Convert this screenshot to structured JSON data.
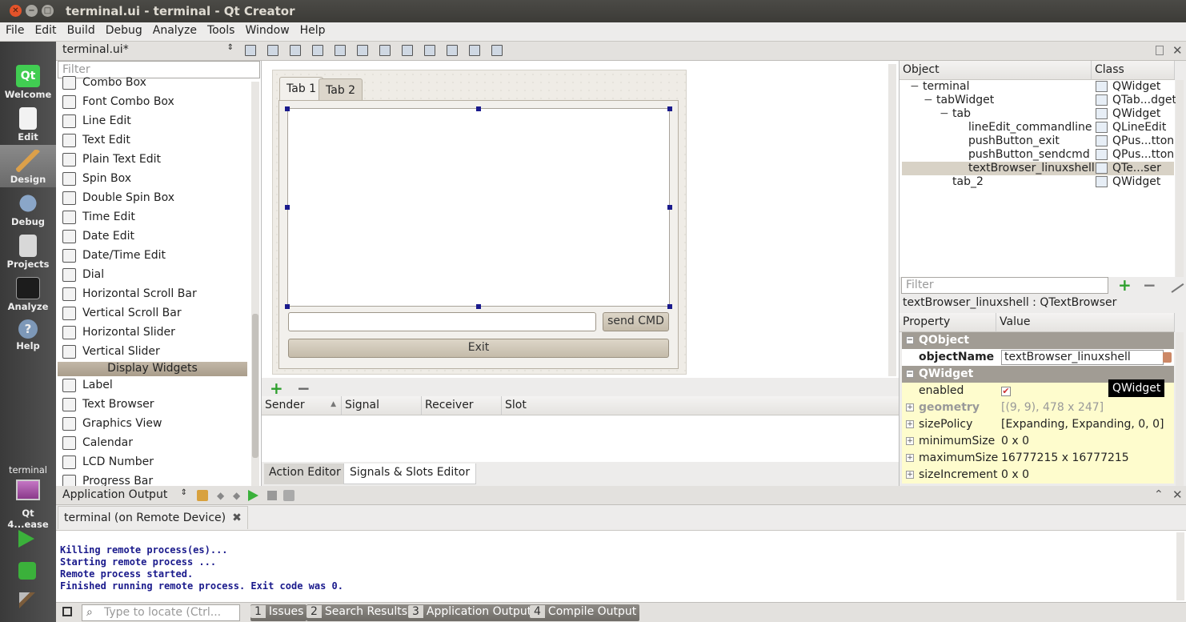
{
  "window": {
    "title": "terminal.ui - terminal - Qt Creator"
  },
  "menu": [
    "File",
    "Edit",
    "Build",
    "Debug",
    "Analyze",
    "Tools",
    "Window",
    "Help"
  ],
  "modes": [
    {
      "label": "Welcome"
    },
    {
      "label": "Edit"
    },
    {
      "label": "Design"
    },
    {
      "label": "Debug"
    },
    {
      "label": "Projects"
    },
    {
      "label": "Analyze"
    },
    {
      "label": "Help"
    }
  ],
  "kit": {
    "project": "terminal",
    "config": "Qt 4...ease"
  },
  "editor": {
    "file": "terminal.ui*"
  },
  "widgetbox": {
    "filter_placeholder": "Filter",
    "items": [
      {
        "label": "Combo Box",
        "icon": "combo-box-icon"
      },
      {
        "label": "Font Combo Box",
        "icon": "font-combo-box-icon"
      },
      {
        "label": "Line Edit",
        "icon": "line-edit-icon"
      },
      {
        "label": "Text Edit",
        "icon": "text-edit-icon"
      },
      {
        "label": "Plain Text Edit",
        "icon": "plain-text-edit-icon"
      },
      {
        "label": "Spin Box",
        "icon": "spin-box-icon"
      },
      {
        "label": "Double Spin Box",
        "icon": "double-spin-box-icon"
      },
      {
        "label": "Time Edit",
        "icon": "time-edit-icon"
      },
      {
        "label": "Date Edit",
        "icon": "date-edit-icon"
      },
      {
        "label": "Date/Time Edit",
        "icon": "date-time-edit-icon"
      },
      {
        "label": "Dial",
        "icon": "dial-icon"
      },
      {
        "label": "Horizontal Scroll Bar",
        "icon": "horizontal-scroll-bar-icon"
      },
      {
        "label": "Vertical Scroll Bar",
        "icon": "vertical-scroll-bar-icon"
      },
      {
        "label": "Horizontal Slider",
        "icon": "horizontal-slider-icon"
      },
      {
        "label": "Vertical Slider",
        "icon": "vertical-slider-icon"
      },
      {
        "label": "Label",
        "icon": "label-icon"
      },
      {
        "label": "Text Browser",
        "icon": "text-browser-icon"
      },
      {
        "label": "Graphics View",
        "icon": "graphics-view-icon"
      },
      {
        "label": "Calendar",
        "icon": "calendar-icon"
      },
      {
        "label": "LCD Number",
        "icon": "lcd-number-icon"
      },
      {
        "label": "Progress Bar",
        "icon": "progress-bar-icon"
      }
    ],
    "category": "Display Widgets"
  },
  "form": {
    "tabs": [
      "Tab 1",
      "Tab 2"
    ],
    "send_label": "send CMD",
    "exit_label": "Exit"
  },
  "signals": {
    "columns": [
      "Sender",
      "Signal",
      "Receiver",
      "Slot"
    ],
    "tabs": [
      "Action Editor",
      "Signals & Slots Editor"
    ]
  },
  "objects": {
    "header": [
      "Object",
      "Class"
    ],
    "rows": [
      {
        "name": "terminal",
        "cls": "QWidget",
        "indent": 0
      },
      {
        "name": "tabWidget",
        "cls": "QTab...dget",
        "indent": 1
      },
      {
        "name": "tab",
        "cls": "QWidget",
        "indent": 2
      },
      {
        "name": "lineEdit_commandline",
        "cls": "QLineEdit",
        "indent": 3
      },
      {
        "name": "pushButton_exit",
        "cls": "QPus...tton",
        "indent": 3
      },
      {
        "name": "pushButton_sendcmd",
        "cls": "QPus...tton",
        "indent": 3
      },
      {
        "name": "textBrowser_linuxshell",
        "cls": "QTe...ser",
        "indent": 3
      },
      {
        "name": "tab_2",
        "cls": "QWidget",
        "indent": 2
      }
    ]
  },
  "props": {
    "filter_placeholder": "Filter",
    "selected": "textBrowser_linuxshell : QTextBrowser",
    "header": [
      "Property",
      "Value"
    ],
    "tooltip": "QWidget",
    "rows": [
      {
        "name": "QObject",
        "value": "",
        "group": true
      },
      {
        "name": "objectName",
        "value": "textBrowser_linuxshell",
        "bold": true
      },
      {
        "name": "QWidget",
        "value": "",
        "group": true
      },
      {
        "name": "enabled",
        "value": "",
        "check": true
      },
      {
        "name": "geometry",
        "value": "[(9, 9), 478 x 247]",
        "expand": true,
        "dim": true
      },
      {
        "name": "sizePolicy",
        "value": "[Expanding, Expanding, 0, 0]",
        "expand": true
      },
      {
        "name": "minimumSize",
        "value": "0 x 0",
        "expand": true
      },
      {
        "name": "maximumSize",
        "value": "16777215 x 16777215",
        "expand": true
      },
      {
        "name": "sizeIncrement",
        "value": "0 x 0",
        "expand": true
      }
    ]
  },
  "output": {
    "pane_title": "Application Output",
    "tab": "terminal (on Remote Device)",
    "lines": [
      "Killing remote process(es)...",
      "Starting remote process ...",
      "Remote process started.",
      "Finished running remote process. Exit code was 0."
    ]
  },
  "status": {
    "locate_placeholder": "Type to locate (Ctrl...",
    "buttons": [
      {
        "n": "1",
        "label": "Issues"
      },
      {
        "n": "2",
        "label": "Search Results"
      },
      {
        "n": "3",
        "label": "Application Output"
      },
      {
        "n": "4",
        "label": "Compile Output"
      }
    ]
  }
}
